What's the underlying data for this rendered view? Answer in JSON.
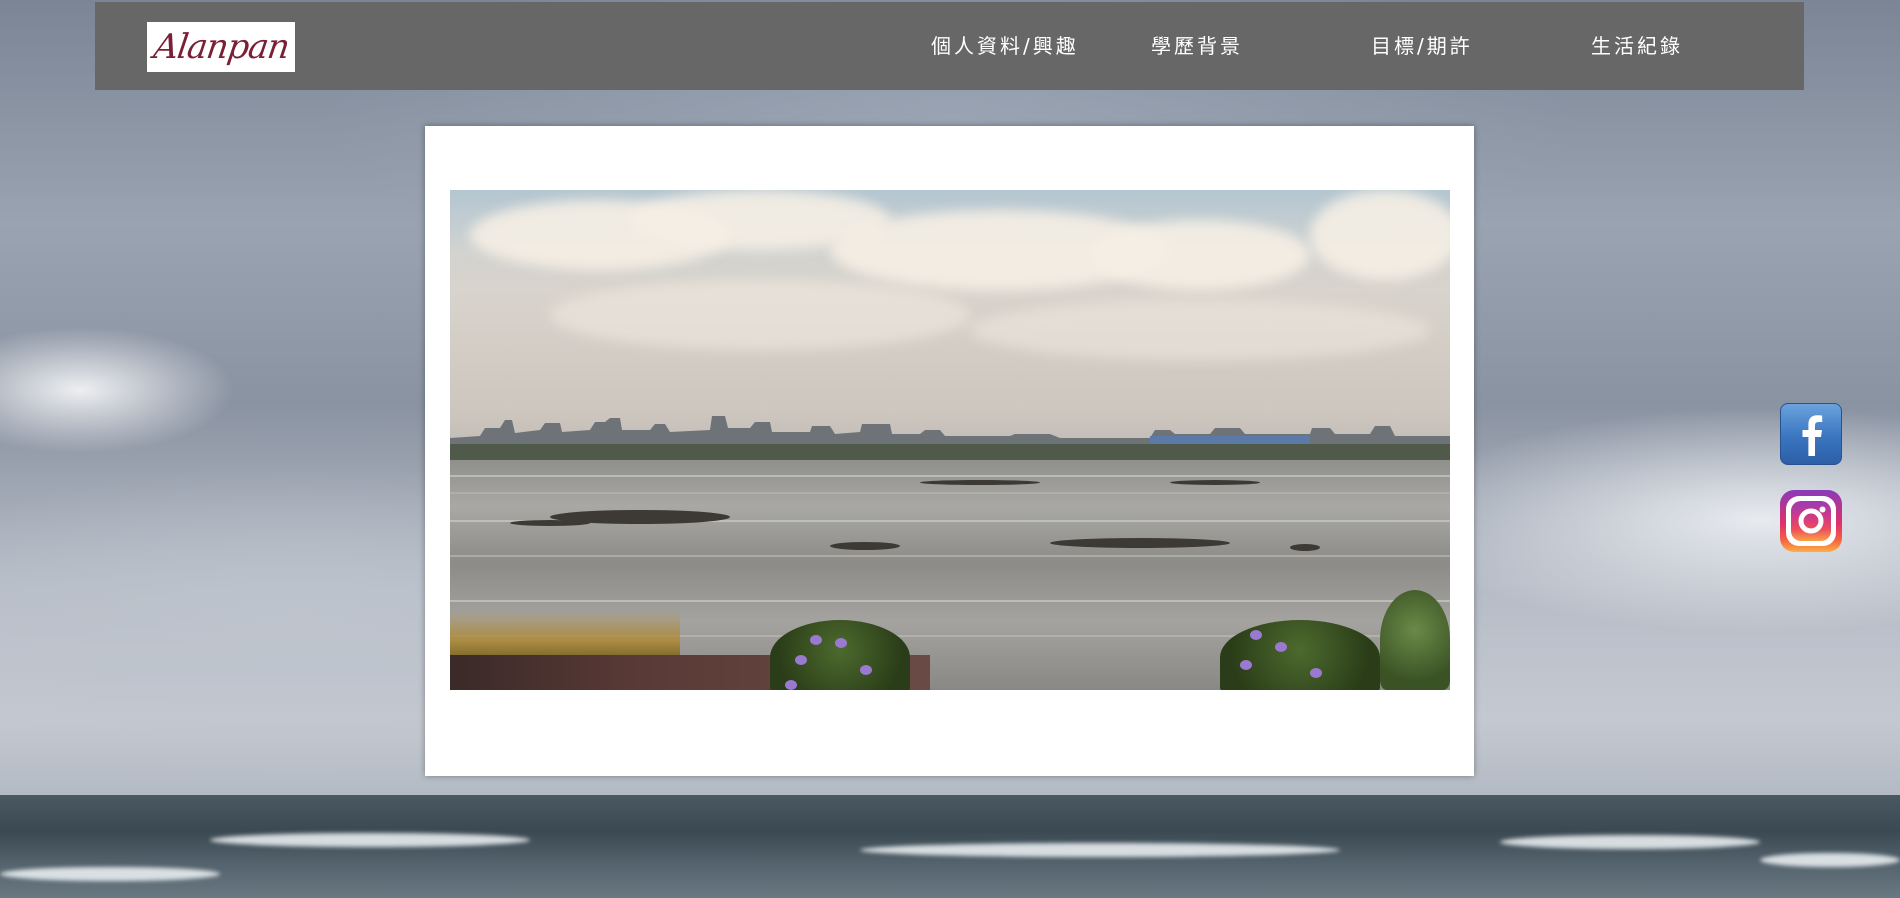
{
  "header": {
    "logo_text": "Alanpan",
    "nav": [
      {
        "label": "個人資料/興趣"
      },
      {
        "label": "學歷背景"
      },
      {
        "label": "目標/期許"
      },
      {
        "label": "生活紀錄"
      }
    ]
  },
  "main": {
    "photo_icon": "coastal-tidal-flat-photo"
  },
  "social": {
    "facebook_icon": "facebook-icon",
    "instagram_icon": "instagram-icon"
  },
  "colors": {
    "header_bg": "#676767",
    "nav_text": "#ffffff",
    "card_bg": "#ffffff"
  }
}
